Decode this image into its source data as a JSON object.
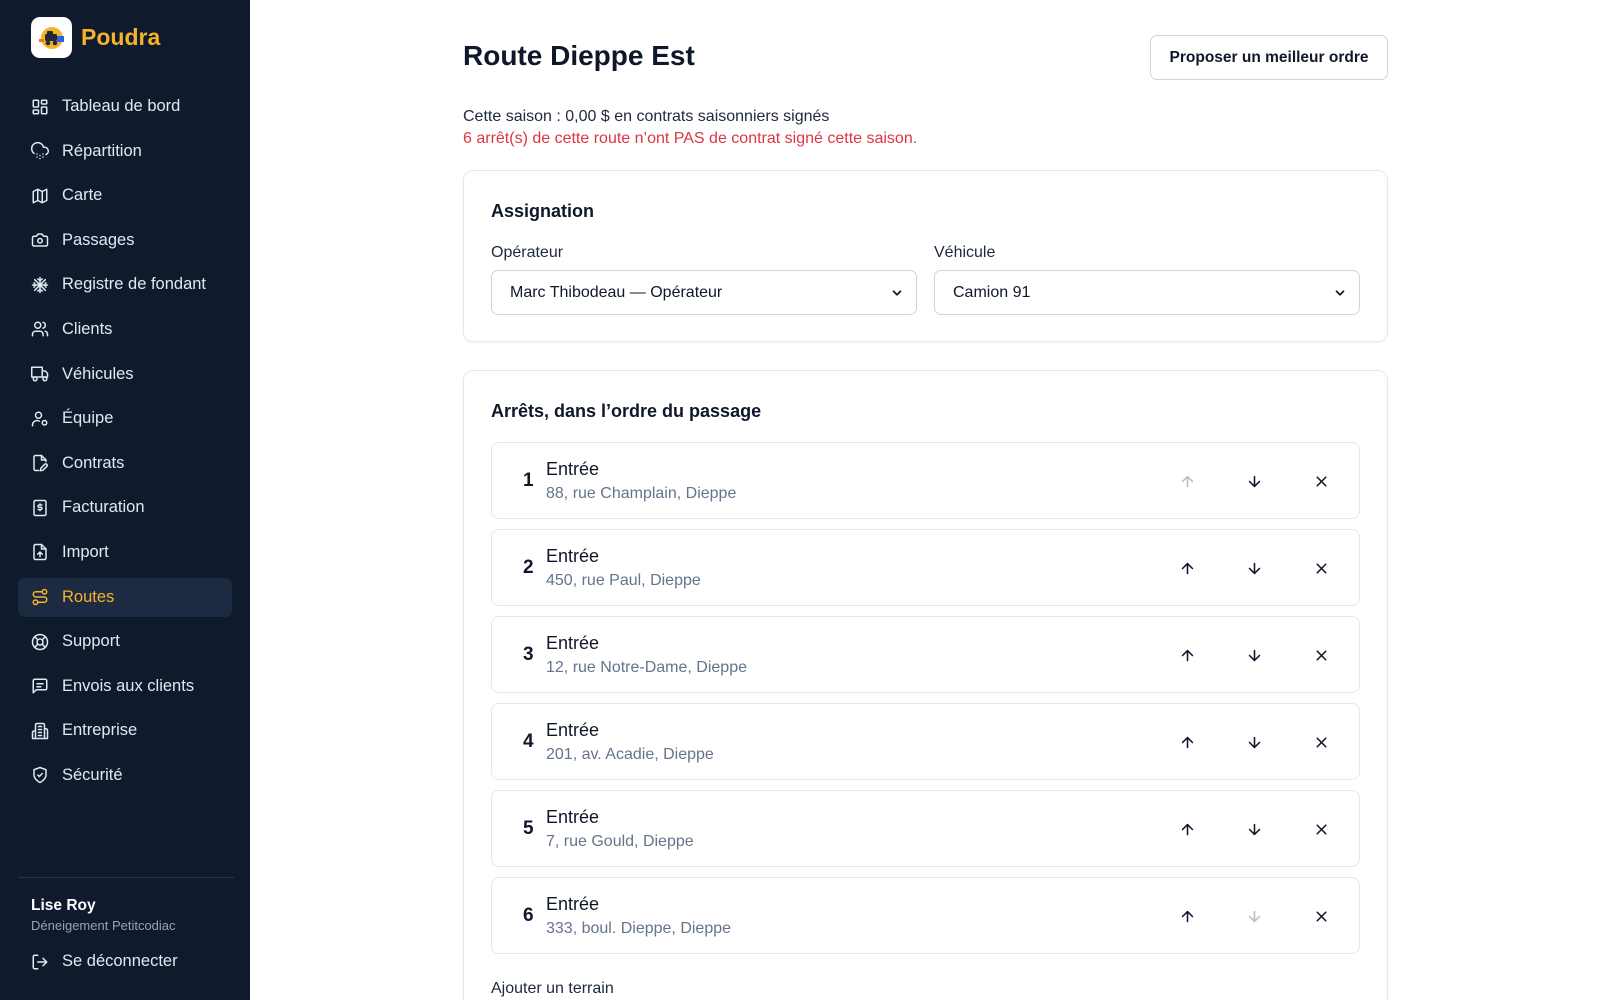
{
  "brand": {
    "name": "Poudra"
  },
  "sidebar": {
    "items": [
      {
        "label": "Tableau de bord",
        "icon": "dashboard-icon"
      },
      {
        "label": "Répartition",
        "icon": "cloud-snow-icon"
      },
      {
        "label": "Carte",
        "icon": "map-icon"
      },
      {
        "label": "Passages",
        "icon": "camera-icon"
      },
      {
        "label": "Registre de fondant",
        "icon": "snowflake-icon"
      },
      {
        "label": "Clients",
        "icon": "users-icon"
      },
      {
        "label": "Véhicules",
        "icon": "truck-icon"
      },
      {
        "label": "Équipe",
        "icon": "user-gear-icon"
      },
      {
        "label": "Contrats",
        "icon": "file-edit-icon"
      },
      {
        "label": "Facturation",
        "icon": "receipt-icon"
      },
      {
        "label": "Import",
        "icon": "file-upload-icon"
      },
      {
        "label": "Routes",
        "icon": "route-icon",
        "active": true
      },
      {
        "label": "Support",
        "icon": "lifebuoy-icon"
      },
      {
        "label": "Envois aux clients",
        "icon": "message-icon"
      },
      {
        "label": "Entreprise",
        "icon": "building-icon"
      },
      {
        "label": "Sécurité",
        "icon": "shield-icon"
      }
    ],
    "user": {
      "name": "Lise Roy",
      "org": "Déneigement Petitcodiac"
    },
    "logout_label": "Se déconnecter"
  },
  "page": {
    "title": "Route Dieppe Est",
    "propose_button": "Proposer un meilleur ordre",
    "season_text": "Cette saison : 0,00 $ en contrats saisonniers signés",
    "warning_text": "6 arrêt(s) de cette route n’ont PAS de contrat signé cette saison."
  },
  "assignment": {
    "title": "Assignation",
    "operator_label": "Opérateur",
    "operator_value": "Marc Thibodeau — Opérateur",
    "vehicle_label": "Véhicule",
    "vehicle_value": "Camion 91"
  },
  "stops": {
    "title": "Arrêts, dans l’ordre du passage",
    "items": [
      {
        "num": "1",
        "name": "Entrée",
        "address": "88, rue Champlain, Dieppe"
      },
      {
        "num": "2",
        "name": "Entrée",
        "address": "450, rue Paul, Dieppe"
      },
      {
        "num": "3",
        "name": "Entrée",
        "address": "12, rue Notre-Dame, Dieppe"
      },
      {
        "num": "4",
        "name": "Entrée",
        "address": "201, av. Acadie, Dieppe"
      },
      {
        "num": "5",
        "name": "Entrée",
        "address": "7, rue Gould, Dieppe"
      },
      {
        "num": "6",
        "name": "Entrée",
        "address": "333, boul. Dieppe, Dieppe"
      }
    ],
    "add_label": "Ajouter un terrain"
  },
  "colors": {
    "sidebar_bg": "#0f1b2d",
    "accent": "#f5b32a",
    "warning": "#dc3545"
  }
}
